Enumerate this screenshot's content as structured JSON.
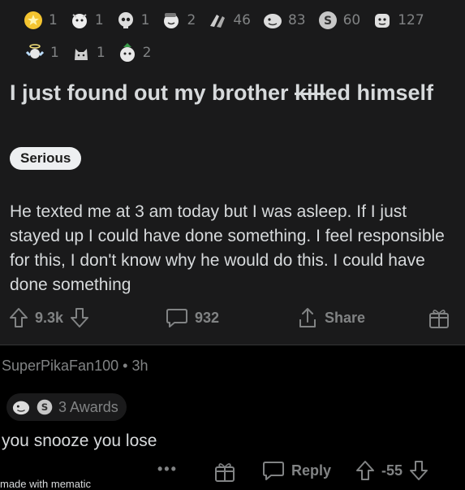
{
  "post": {
    "award_counts_row1": [
      "1",
      "1",
      "1",
      "2",
      "46",
      "83",
      "60",
      "127"
    ],
    "award_counts_row2": [
      "1",
      "1",
      "2"
    ],
    "title_prefix": "I just found out my brother ",
    "title_struck": "kill",
    "title_suffix": "ed himself",
    "flair": "Serious",
    "body": "He texted me at 3 am today but I was asleep. If I just stayed up I could have done something. I feel responsible for this, I don't know why he would do this. I could have done something",
    "upvotes": "9.3k",
    "comments": "932",
    "share_label": "Share"
  },
  "comment": {
    "author": "SuperPikaFan100",
    "separator": "•",
    "age": "3h",
    "awards_label": "3 Awards",
    "text": "you snooze you lose",
    "more_label": "•••",
    "reply_label": "Reply",
    "score": "-55",
    "cutoff_text": "made with mematic"
  },
  "colors": {
    "card": "#1a1a1b",
    "muted": "#818384",
    "text": "#d7dadc"
  }
}
